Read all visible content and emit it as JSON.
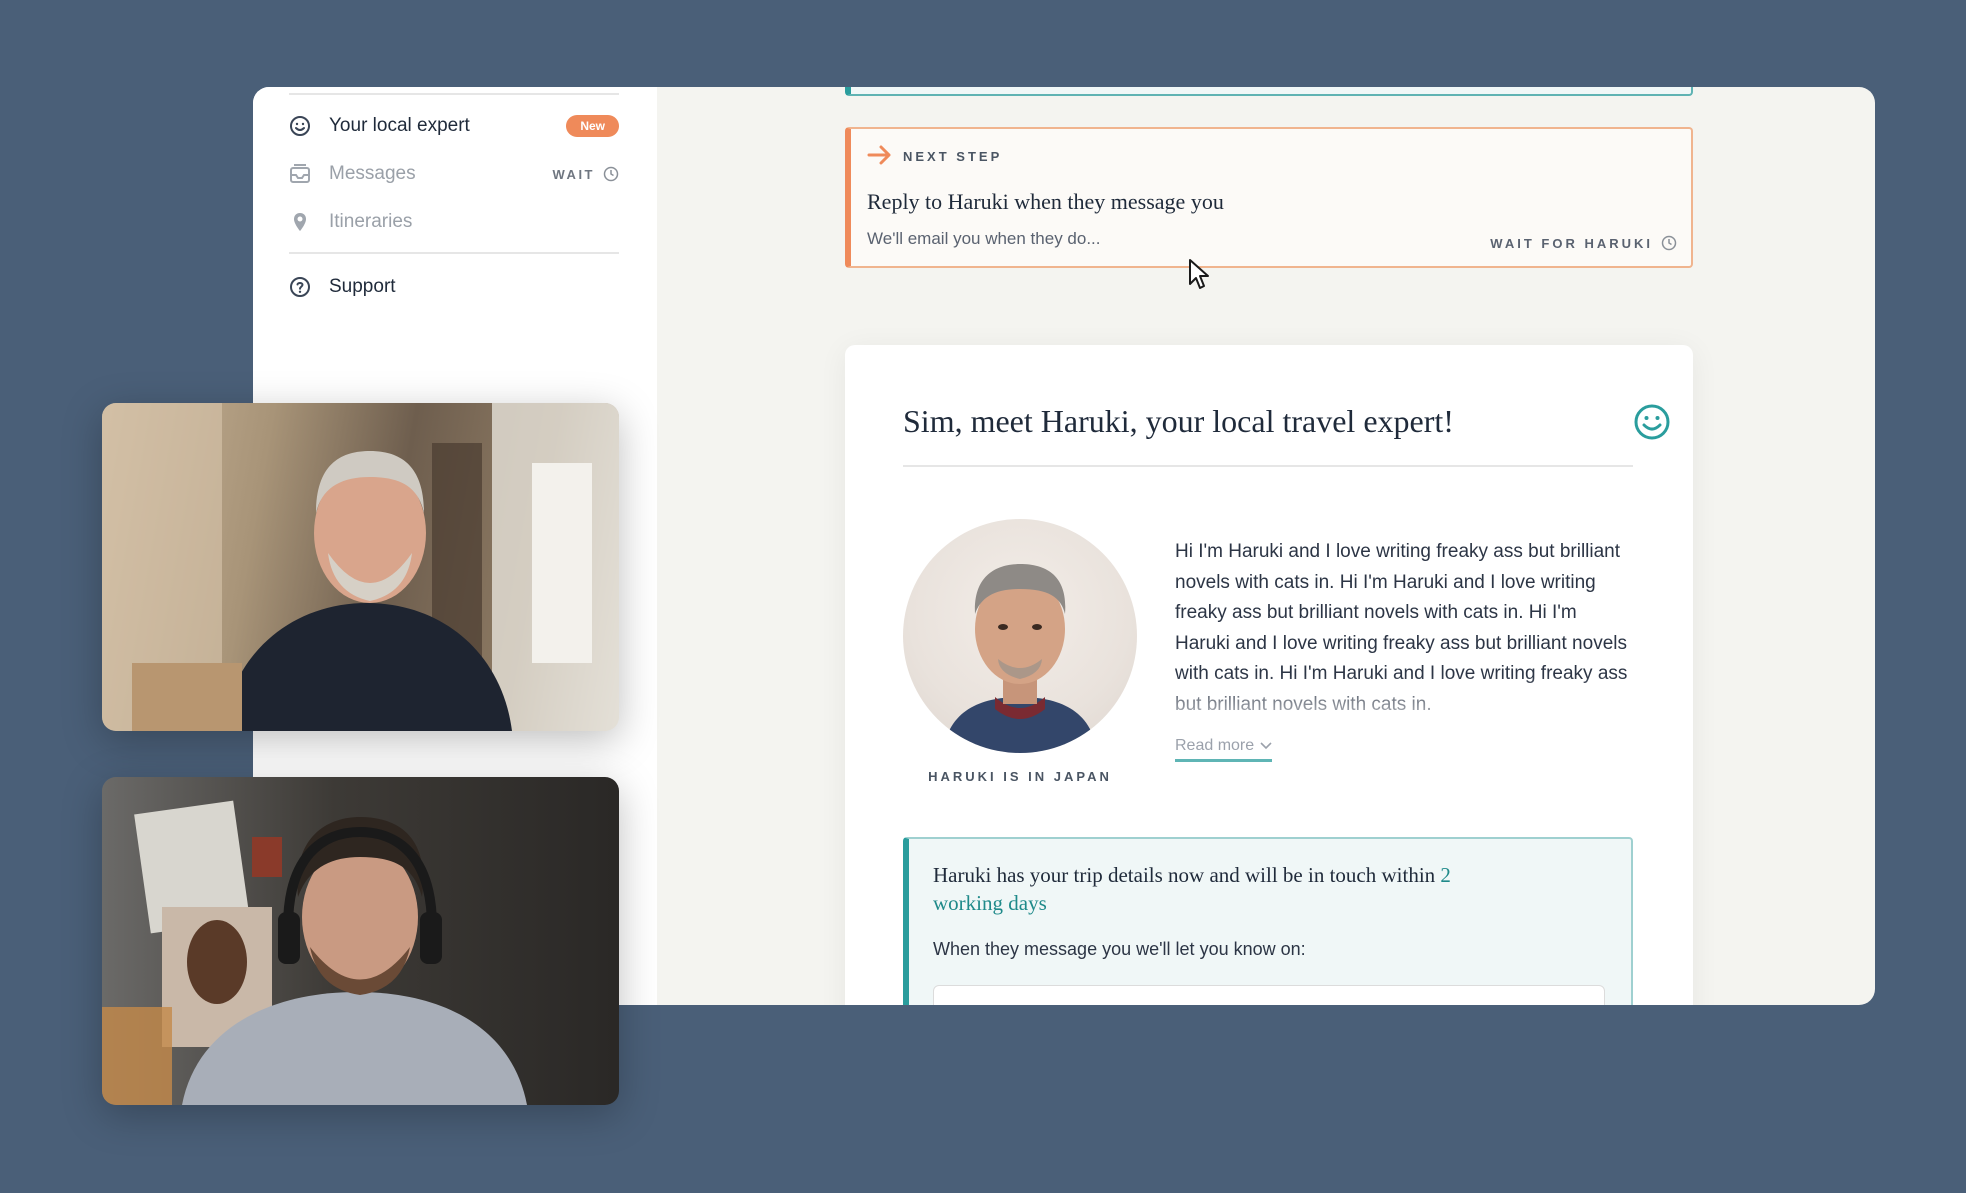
{
  "sidebar": {
    "items": [
      {
        "label": "Your local expert",
        "badge": "New",
        "icon": "smile-icon"
      },
      {
        "label": "Messages",
        "status": "WAIT",
        "icon": "inbox-icon"
      },
      {
        "label": "Itineraries",
        "icon": "map-pin-icon"
      },
      {
        "label": "Support",
        "icon": "help-circle-icon"
      }
    ]
  },
  "next_step": {
    "kicker": "NEXT STEP",
    "title": "Reply to Haruki when they message you",
    "subtitle": "We'll email you when they do...",
    "status": "WAIT FOR HARUKI"
  },
  "intro": {
    "title": "Sim, meet Haruki, your local travel expert!",
    "location": "HARUKI IS IN JAPAN",
    "bio": "Hi I'm Haruki and I love writing freaky ass but brilliant novels with cats in. Hi I'm Haruki and I love writing freaky ass but brilliant novels with cats in. Hi I'm Haruki and I love writing freaky ass but brilliant novels with cats in. Hi I'm Haruki and I love writing freaky ass but brilliant novels with cats in.",
    "read_more": "Read more"
  },
  "info_box": {
    "headline_prefix": "Haruki has your trip details now and will be in touch within ",
    "headline_highlight": "2 working days",
    "subtext": "When they message you we'll let you know on:"
  },
  "colors": {
    "background": "#4a5f78",
    "accent_teal": "#2a9d9d",
    "accent_orange": "#ef8a5a"
  }
}
